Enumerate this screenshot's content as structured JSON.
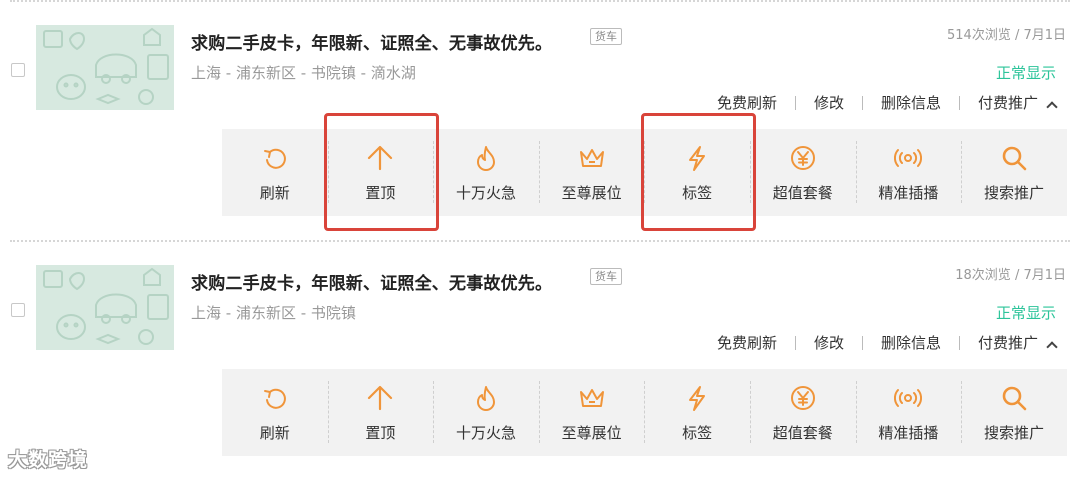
{
  "listings": [
    {
      "title": "求购二手皮卡，年限新、证照全、无事故优先。",
      "tag": "货车",
      "location": "上海 - 浦东新区 - 书院镇 - 滴水湖",
      "meta": "514次浏览 / 7月1日",
      "status": "正常显示",
      "actions": {
        "refresh_free": "免费刷新",
        "edit": "修改",
        "delete": "删除信息",
        "paid_promo": "付费推广"
      },
      "tools": [
        {
          "label": "刷新",
          "icon": "refresh-icon"
        },
        {
          "label": "置顶",
          "icon": "arrow-up-icon"
        },
        {
          "label": "十万火急",
          "icon": "flame-icon"
        },
        {
          "label": "至尊展位",
          "icon": "crown-icon"
        },
        {
          "label": "标签",
          "icon": "lightning-icon"
        },
        {
          "label": "超值套餐",
          "icon": "yen-icon"
        },
        {
          "label": "精准插播",
          "icon": "broadcast-icon"
        },
        {
          "label": "搜索推广",
          "icon": "search-icon"
        }
      ]
    },
    {
      "title": "求购二手皮卡，年限新、证照全、无事故优先。",
      "tag": "货车",
      "location": "上海 - 浦东新区 - 书院镇",
      "meta": "18次浏览 / 7月1日",
      "status": "正常显示",
      "actions": {
        "refresh_free": "免费刷新",
        "edit": "修改",
        "delete": "删除信息",
        "paid_promo": "付费推广"
      },
      "tools": [
        {
          "label": "刷新",
          "icon": "refresh-icon"
        },
        {
          "label": "置顶",
          "icon": "arrow-up-icon"
        },
        {
          "label": "十万火急",
          "icon": "flame-icon"
        },
        {
          "label": "至尊展位",
          "icon": "crown-icon"
        },
        {
          "label": "标签",
          "icon": "lightning-icon"
        },
        {
          "label": "超值套餐",
          "icon": "yen-icon"
        },
        {
          "label": "精准插播",
          "icon": "broadcast-icon"
        },
        {
          "label": "搜索推广",
          "icon": "search-icon"
        }
      ]
    }
  ],
  "watermark": "大数跨境",
  "colors": {
    "accent_orange": "#f0953a",
    "status_green": "#2cc49a",
    "highlight_red": "#d9443a",
    "toolbar_bg": "#f2f2f2"
  }
}
